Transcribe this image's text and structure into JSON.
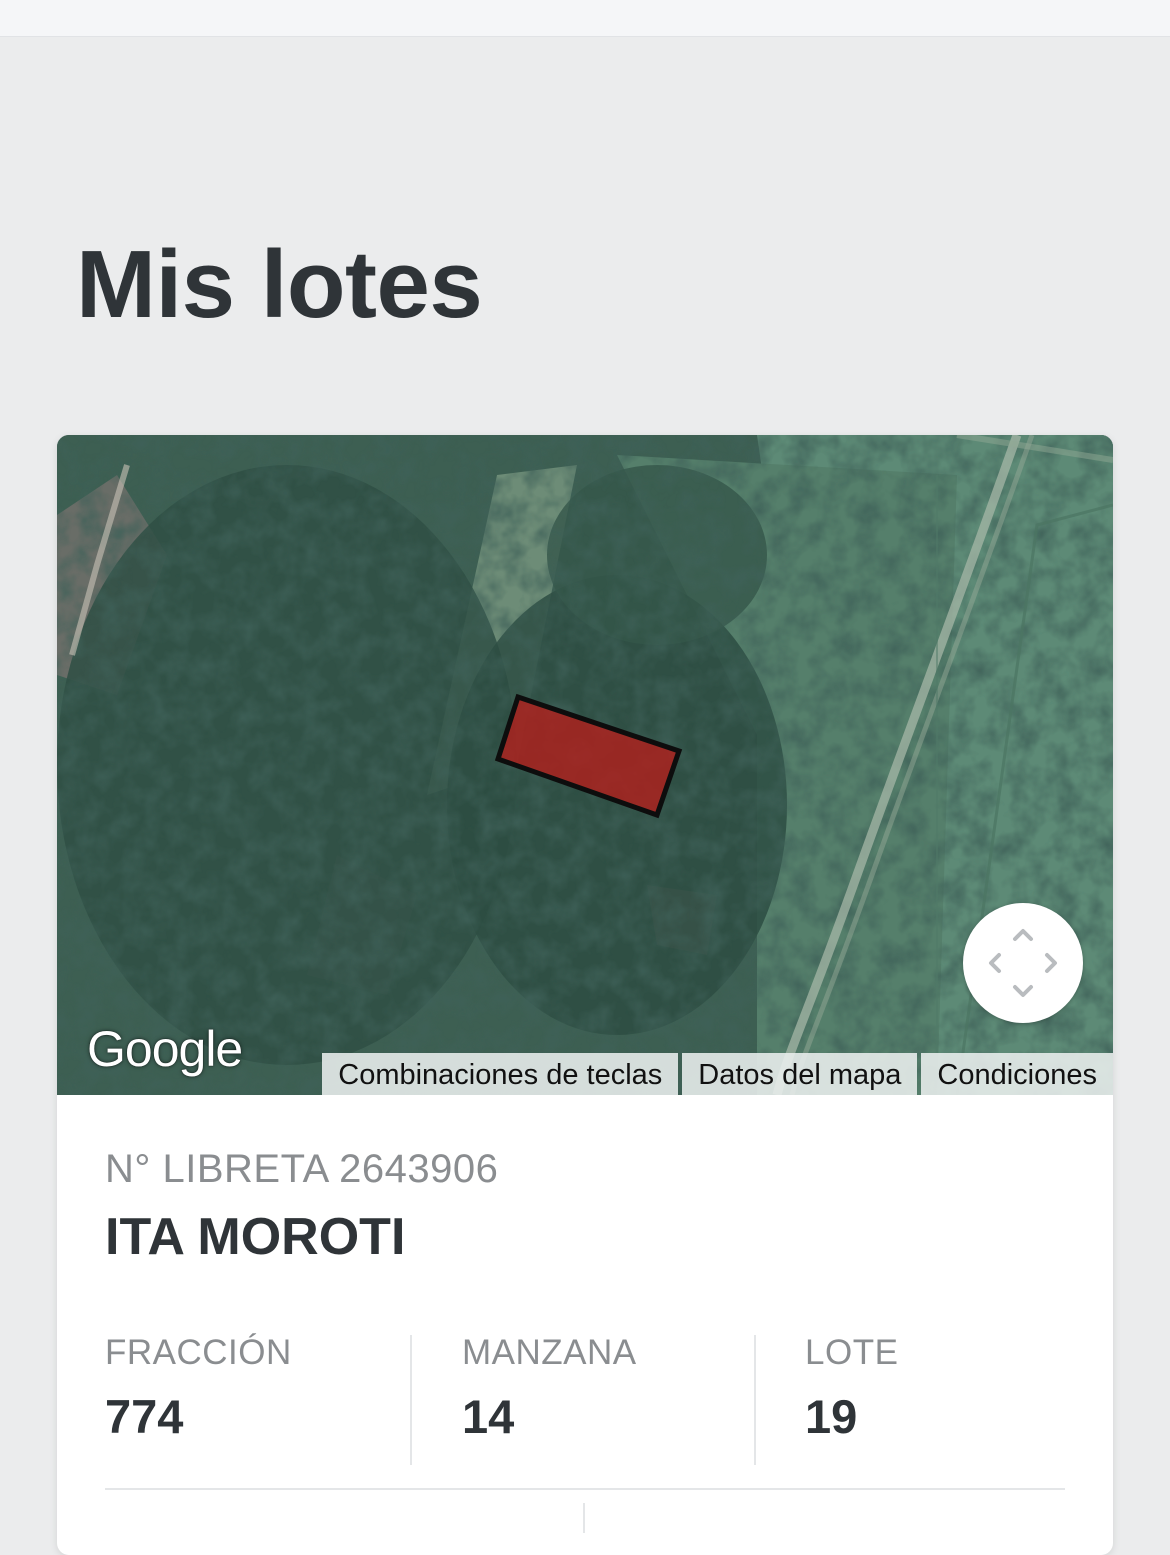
{
  "page": {
    "title": "Mis lotes"
  },
  "map": {
    "logo": "Google",
    "footer_links": [
      "Combinaciones de teclas",
      "Datos del mapa",
      "Condiciones"
    ],
    "fullscreen_icon": "fullscreen-arrows-icon",
    "parcel_color": "#b0201c"
  },
  "lot": {
    "libreta": "N° LIBRETA 2643906",
    "name": "ITA MOROTI",
    "stats": [
      {
        "label": "FRACCIÓN",
        "value": "774"
      },
      {
        "label": "MANZANA",
        "value": "14"
      },
      {
        "label": "LOTE",
        "value": "19"
      }
    ]
  }
}
